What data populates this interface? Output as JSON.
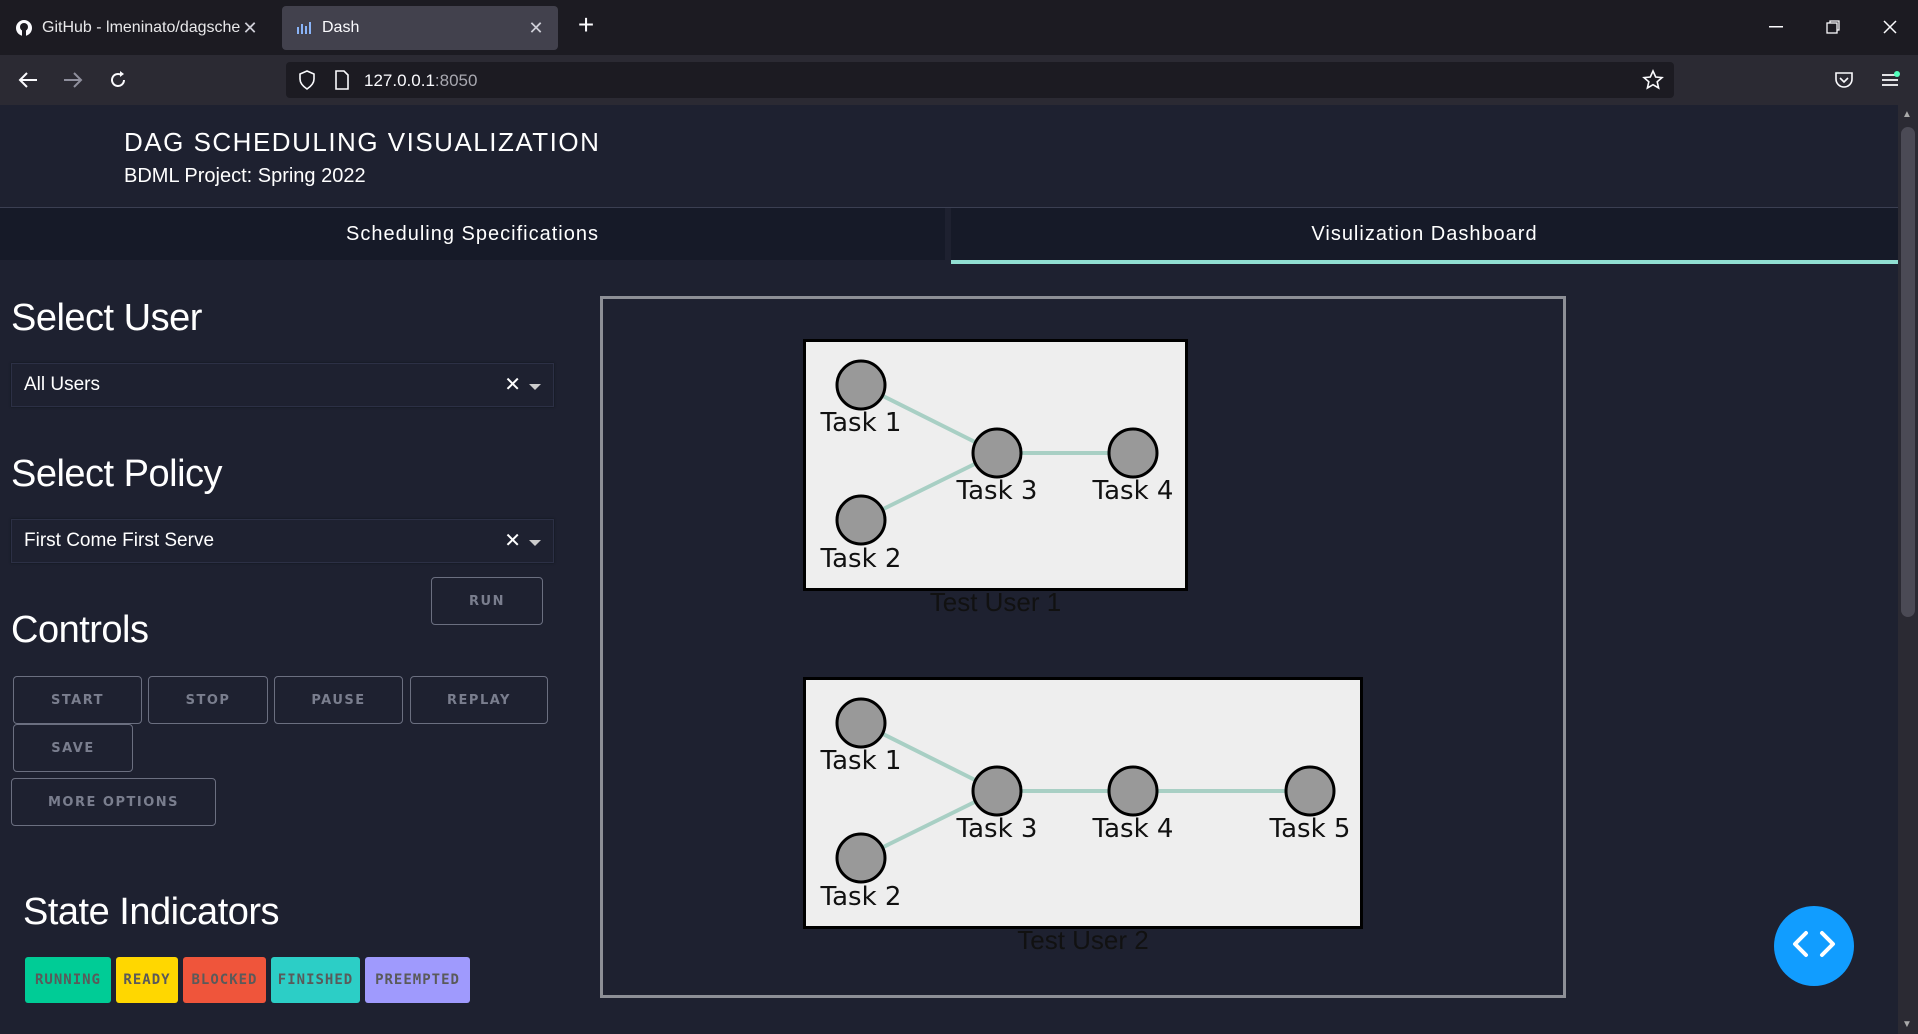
{
  "browser": {
    "tabs": [
      {
        "label": "GitHub - lmeninato/dagsched",
        "icon": "github-icon",
        "active": false
      },
      {
        "label": "Dash",
        "icon": "dash-icon",
        "active": true
      }
    ],
    "url_host": "127.0.0.1",
    "url_port": ":8050"
  },
  "header": {
    "title": "DAG SCHEDULING VISUALIZATION",
    "subtitle": "BDML Project: Spring 2022"
  },
  "page_tabs": [
    {
      "label": "Scheduling Specifications",
      "selected": false
    },
    {
      "label": "Visulization Dashboard",
      "selected": true
    }
  ],
  "sidebar": {
    "select_user_heading": "Select User",
    "user_value": "All Users",
    "select_policy_heading": "Select Policy",
    "policy_value": "First Come First Serve",
    "run_label": "RUN",
    "controls_heading": "Controls",
    "controls": {
      "start": "START",
      "stop": "STOP",
      "pause": "PAUSE",
      "replay": "REPLAY",
      "save": "SAVE",
      "more": "MORE OPTIONS"
    },
    "state_heading": "State Indicators",
    "states": [
      {
        "label": "RUNNING",
        "color": "#00cc96"
      },
      {
        "label": "READY",
        "color": "#ffd700"
      },
      {
        "label": "BLOCKED",
        "color": "#ef553b"
      },
      {
        "label": "FINISHED",
        "color": "#2ccec6"
      },
      {
        "label": "PREEMPTED",
        "color": "#9f9afd"
      }
    ]
  },
  "graphs": [
    {
      "caption": "Test User 1",
      "nodes": [
        "Task 1",
        "Task 2",
        "Task 3",
        "Task 4"
      ],
      "edges": [
        [
          "Task 1",
          "Task 3"
        ],
        [
          "Task 2",
          "Task 3"
        ],
        [
          "Task 3",
          "Task 4"
        ]
      ]
    },
    {
      "caption": "Test User 2",
      "nodes": [
        "Task 1",
        "Task 2",
        "Task 3",
        "Task 4",
        "Task 5"
      ],
      "edges": [
        [
          "Task 1",
          "Task 3"
        ],
        [
          "Task 2",
          "Task 3"
        ],
        [
          "Task 3",
          "Task 4"
        ],
        [
          "Task 4",
          "Task 5"
        ]
      ]
    }
  ],
  "colors": {
    "node_fill": "#999999",
    "edge": "#a8cfc4",
    "accent_tab": "#91dfd2",
    "fab": "#119dff"
  }
}
